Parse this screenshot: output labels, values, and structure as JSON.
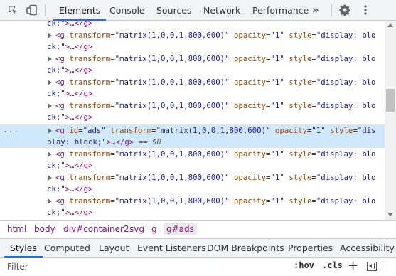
{
  "toolbar": {
    "tabs": [
      {
        "label": "Elements"
      },
      {
        "label": "Console"
      },
      {
        "label": "Sources"
      },
      {
        "label": "Network"
      },
      {
        "label": "Performance"
      }
    ],
    "more_tabs": "»",
    "icons": [
      "inspect-element-icon",
      "device-toolbar-icon",
      "settings-gear-icon",
      "more-options-icon"
    ]
  },
  "tree": {
    "selected_line_1": {
      "open": "<g ",
      "id_attr": "id",
      "id_val": "\"ads\"",
      "transform_attr": "transform",
      "transform_val": "\"matrix(1,0,0,1,800,600)\"",
      "opacity_attr": "opacity",
      "opacity_val": "\"1\"",
      "style_attr": "style",
      "style_val_part1": "\"dis"
    },
    "selected_line_2": {
      "style_val_part2": "play: block;\"",
      "ellipsis": ">…</",
      "close_tag": "g",
      "close_end": ">",
      "dollar": " == $0"
    },
    "row": {
      "open": "<g ",
      "transform_attr": "transform",
      "transform_val": "\"matrix(1,0,0,1,800,600)\"",
      "opacity_attr": "opacity",
      "opacity_val": "\"1\"",
      "style_attr": "style",
      "style_val": "\"display: blo",
      "cont_val": "ck;\"",
      "cont_rest": ">…</",
      "cont_tag": "g",
      "cont_end": ">"
    },
    "dots": "..."
  },
  "breadcrumbs": [
    {
      "label": "html"
    },
    {
      "label": "body"
    },
    {
      "label": "div#container2"
    },
    {
      "label": "svg"
    },
    {
      "label": "g"
    },
    {
      "label": "g#ads"
    }
  ],
  "lower_tabs": [
    {
      "label": "Styles"
    },
    {
      "label": "Computed"
    },
    {
      "label": "Layout"
    },
    {
      "label": "Event Listeners"
    },
    {
      "label": "DOM Breakpoints"
    },
    {
      "label": "Properties"
    },
    {
      "label": "Accessibility"
    }
  ],
  "filter": {
    "placeholder": "Filter",
    "hov": ":hov",
    "cls": ".cls",
    "plus": "+"
  }
}
